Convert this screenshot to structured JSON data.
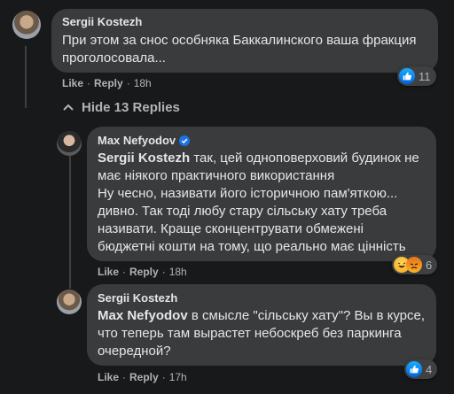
{
  "comment_main": {
    "author": "Sergii Kostezh",
    "text_line1": "При этом за снос особняка Баккалинского ваша фракция",
    "text_line2": "проголосовала...",
    "reaction_count": "11",
    "like_label": "Like",
    "reply_label": "Reply",
    "time": "18h"
  },
  "hide_replies_label": "Hide 13 Replies",
  "reply1": {
    "author": "Max Nefyodov",
    "mention": "Sergii Kostezh",
    "line1": " так, цей одноповерховий будинок не",
    "line2": "має ніякого практичного використання",
    "line3": "Ну чесно, називати його історичною пам'яткою...",
    "line4": "дивно. Так тоді любу стару сільську хату треба",
    "line5": "називати. Краще сконцентрувати обмежені",
    "line6": "бюджетні кошти на тому, що реально має цінність",
    "reaction_count": "6",
    "like_label": "Like",
    "reply_label": "Reply",
    "time": "18h"
  },
  "reply2": {
    "author": "Sergii Kostezh",
    "mention": "Max Nefyodov",
    "line1": " в смысле \"сільську хату\"? Вы в курсе,",
    "line2": "что теперь там вырастет небоскреб без паркинга",
    "line3": "очередной?",
    "reaction_count": "4",
    "like_label": "Like",
    "reply_label": "Reply",
    "time": "17h"
  },
  "colors": {
    "background": "#18191a",
    "bubble": "#3a3b3c",
    "text": "#e4e6eb",
    "secondary": "#b0b3b8",
    "like_blue": "#1877f2",
    "verified": "#1b74e4"
  }
}
